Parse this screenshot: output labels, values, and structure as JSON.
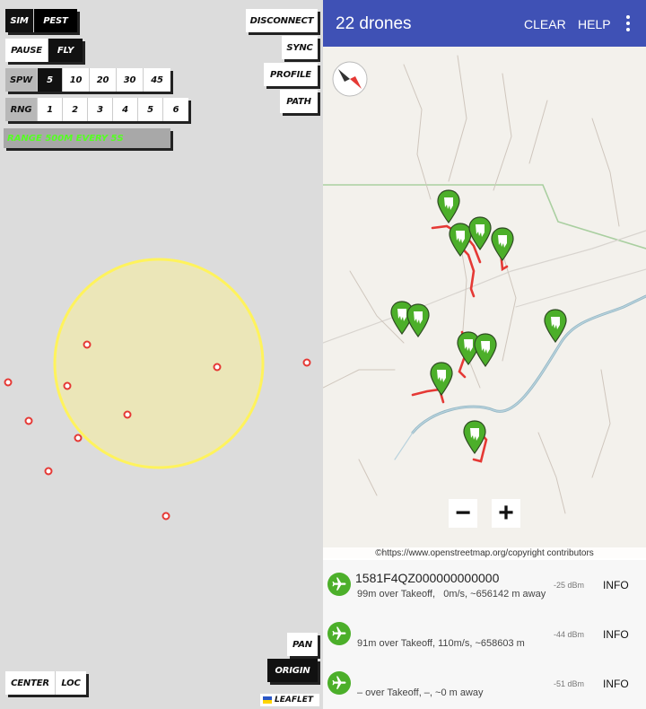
{
  "sim": {
    "row1": [
      "SIM",
      "PEST"
    ],
    "row2": [
      "PAUSE",
      "FLY"
    ],
    "row3": [
      "SPW",
      "5",
      "10",
      "20",
      "30",
      "45"
    ],
    "row4": [
      "RNG",
      "1",
      "2",
      "3",
      "4",
      "5",
      "6"
    ],
    "range_text": "RANGE 500M EVERY 5S",
    "disconnect": "DISCONNECT",
    "sync": "SYNC",
    "profile": "PROFILE",
    "path": "PATH",
    "pan": "PAN",
    "origin": "ORIGIN",
    "center": "CENTER",
    "loc": "LOC",
    "leaflet": "LEAFLET",
    "range_circle_color": "#fff35c",
    "marker_color": "#e53935"
  },
  "app": {
    "title": "22 drones",
    "clear": "CLEAR",
    "help": "HELP",
    "more_icon": "more-vert-icon",
    "accent": "#3f51b5"
  },
  "map": {
    "zoom_out": "−",
    "zoom_in": "+",
    "attribution": "©https://www.openstreetmap.org/copyright contributors",
    "compass_icon": "compass-icon",
    "pin_icon": "drone-pin-icon",
    "pin_color": "#4caf2a",
    "track_color": "#e53935"
  },
  "drones": [
    {
      "name": "1581F4QZ000000000000",
      "detail": "99m over Takeoff,   0m/s, ~656142 m away",
      "dbm": "-25 dBm",
      "info": "INFO"
    },
    {
      "name": "",
      "detail": "91m over Takeoff, 110m/s, ~658603 m",
      "dbm": "-44 dBm",
      "info": "INFO"
    },
    {
      "name": "",
      "detail": "– over Takeoff, –, ~0 m away",
      "dbm": "-51 dBm",
      "info": "INFO"
    }
  ]
}
